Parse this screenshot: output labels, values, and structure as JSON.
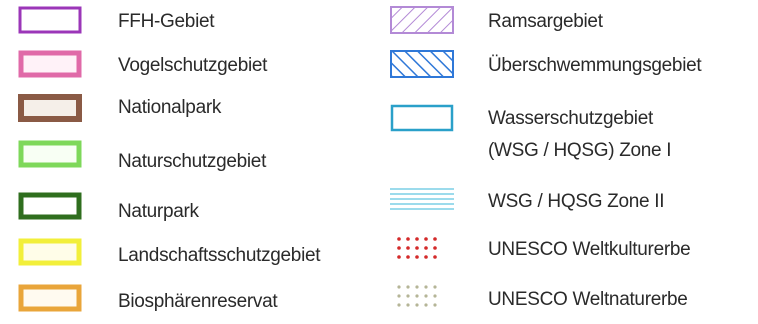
{
  "legend": {
    "left": [
      {
        "label": "FFH-Gebiet",
        "symbol": "ffh-area",
        "stroke": "#9b36b8",
        "fill": "#ffffff"
      },
      {
        "label": "Vogelschutzgebiet",
        "symbol": "bird-protection-area",
        "stroke": "#e06aa8",
        "fill": "#fff2f8"
      },
      {
        "label": "Nationalpark",
        "symbol": "national-park",
        "stroke": "#8a5a45",
        "fill": "#f5efe9"
      },
      {
        "label": "Naturschutzgebiet",
        "symbol": "nature-reserve",
        "stroke": "#7ed85a",
        "fill": "#f8fff4"
      },
      {
        "label": "Naturpark",
        "symbol": "nature-park",
        "stroke": "#2f6e1e",
        "fill": "#ffffff"
      },
      {
        "label": "Landschaftsschutzgebiet",
        "symbol": "landscape-protection-area",
        "stroke": "#f2ef3a",
        "fill": "#fffde8"
      },
      {
        "label": "Biosphärenreservat",
        "symbol": "biosphere-reserve",
        "stroke": "#e9a53a",
        "fill": "#fffaf0"
      }
    ],
    "right": [
      {
        "label": "Ramsargebiet",
        "symbol": "ramsar-hatch",
        "stroke": "#b38ad6"
      },
      {
        "label": "Überschwemmungsgebiet",
        "symbol": "flood-hatch",
        "stroke": "#2f78d8"
      },
      {
        "label_line1": "Wasserschutzgebiet",
        "label_line2": "(WSG / HQSG) Zone I",
        "symbol": "water-zone-1",
        "stroke": "#2aa0c9"
      },
      {
        "label": "WSG / HQSG Zone II",
        "symbol": "water-zone-2-stripes",
        "stroke": "#7ccfe6"
      },
      {
        "label": "UNESCO Weltkulturerbe",
        "symbol": "cultural-heritage-dots",
        "stroke": "#d42a2a"
      },
      {
        "label": "UNESCO Weltnaturerbe",
        "symbol": "natural-heritage-dots",
        "stroke": "#b5b597"
      }
    ]
  }
}
